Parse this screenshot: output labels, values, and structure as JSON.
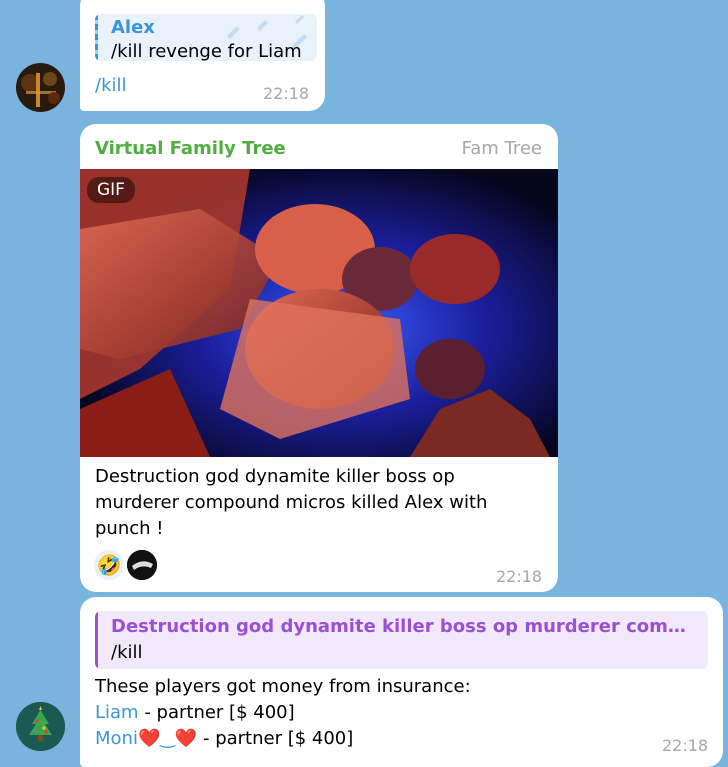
{
  "messages": [
    {
      "reply": {
        "name": "Alex",
        "text": "/kill revenge for Liam"
      },
      "text": "/kill",
      "time": "22:18"
    },
    {
      "sender": "Virtual Family Tree",
      "via": "Fam Tree",
      "media_badge": "GIF",
      "caption": "Destruction god dynamite killer boss op murderer compound micros killed Alex with punch !",
      "reactions": [
        "🤣",
        "avatar"
      ],
      "time": "22:18"
    },
    {
      "reply": {
        "name": "Destruction god dynamite killer boss op murderer compound ...",
        "text": "/kill"
      },
      "lines": {
        "intro": "These players got money from insurance:",
        "p1_name": "Liam",
        "p1_rest": " - partner [$ 400]",
        "p2_name": "Moni❤️‿❤️",
        "p2_rest": " - partner [$ 400]"
      },
      "time": "22:18"
    }
  ],
  "colors": {
    "background": "#79b4df",
    "link": "#3a95d6",
    "sender": "#4fae3e",
    "reply_accent": "#9b4fd1"
  }
}
